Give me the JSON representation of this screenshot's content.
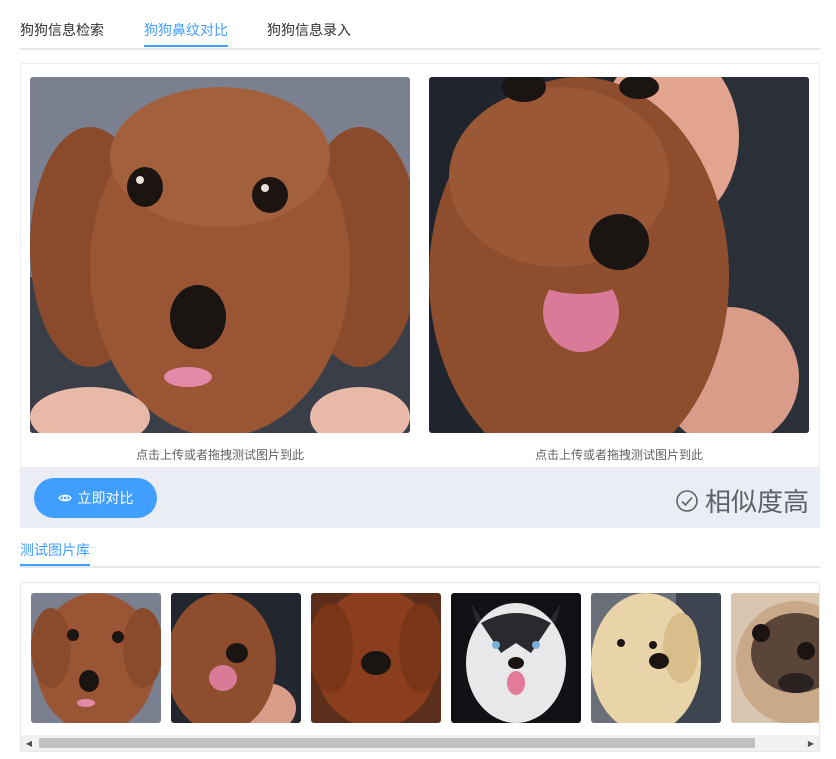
{
  "tabs": [
    {
      "label": "狗狗信息检索",
      "active": false
    },
    {
      "label": "狗狗鼻纹对比",
      "active": true
    },
    {
      "label": "狗狗信息录入",
      "active": false
    }
  ],
  "compare": {
    "upload_hint_left": "点击上传或者拖拽测试图片到此",
    "upload_hint_right": "点击上传或者拖拽测试图片到此",
    "compare_button": "立即对比",
    "result": "相似度高"
  },
  "gallery": {
    "title": "测试图片库"
  },
  "colors": {
    "accent": "#409eff",
    "footer_bg": "#eaedf4"
  }
}
